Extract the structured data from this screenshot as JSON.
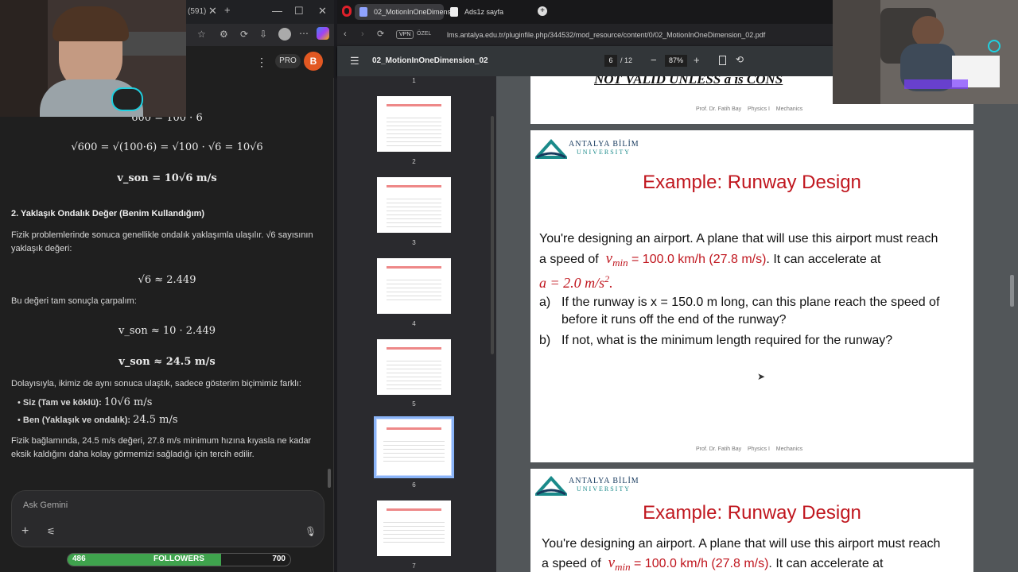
{
  "left": {
    "tab_count": "(591)",
    "pro_label": "PRO",
    "avatar_letter": "B",
    "math": {
      "eq1": "600 = 100 · 6",
      "eq2": "√600 = √(100·6) = √100 · √6 = 10√6",
      "eq3": "v_son = 10√6 m/s",
      "eq4": "√6 ≈ 2.449",
      "eq5": "v_son ≈ 10 · 2.449",
      "eq6": "v_son ≈ 24.5 m/s"
    },
    "heading2": "2. Yaklaşık Ondalık Değer (Benim Kullandığım)",
    "para1": "Fizik problemlerinde sonuca genellikle ondalık yaklaşımla ulaşılır. √6 sayısının yaklaşık değeri:",
    "para2": "Bu değeri tam sonuçla çarpalım:",
    "para3": "Dolayısıyla, ikimiz de aynı sonuca ulaştık, sadece gösterim biçimimiz farklı:",
    "bullets": [
      {
        "label": "Siz (Tam ve köklü):",
        "value": "10√6 m/s"
      },
      {
        "label": "Ben (Yaklaşık ve ondalık):",
        "value": "24.5 m/s"
      }
    ],
    "para4": "Fizik bağlamında, 24.5 m/s değeri, 27.8 m/s minimum hızına kıyasla ne kadar eksik kaldığını daha kolay görmemizi sağladığı için tercih edilir.",
    "ask_placeholder": "Ask Gemini",
    "followers": {
      "current": "486",
      "label": "FOLLOWERS",
      "goal": "700",
      "progress": 0.69
    }
  },
  "right": {
    "tabs": [
      {
        "label": "02_MotionInOneDimensio"
      },
      {
        "label": "Ads1z sayfa"
      }
    ],
    "vpn": "VPN",
    "ozel": "ÖZEL",
    "url": "lms.antalya.edu.tr/pluginfile.php/344532/mod_resource/content/0/02_MotionInOneDimension_02.pdf",
    "pdf": {
      "title": "02_MotionInOneDimension_02",
      "page": "6",
      "total": "/ 12",
      "zoom": "87%"
    },
    "thumb_numbers": [
      "1",
      "2",
      "3",
      "4",
      "5",
      "6",
      "7"
    ],
    "prev_page_title": "NOT VALID UNLESS a is CONS",
    "footer": {
      "author": "Prof. Dr. Fatih Bay",
      "course": "Physics I",
      "topic": "Mechanics"
    },
    "logo_line1": "ANTALYA BİLİM",
    "logo_line2": "UNIVERSITY",
    "slide": {
      "title": "Example: Runway Design",
      "intro1": "You're designing an airport. A plane that will use this airport must reach",
      "intro2a": "a speed of",
      "vmin": "v",
      "vmin_sub": "min",
      "intro2b": "= 100.0 km/h (27.8 m/s)",
      "intro2c": ". It can accelerate at",
      "accel": "a = 2.0 m/s",
      "accel_exp": "2",
      "qa_label": "a)",
      "qa1": "If the runway is x = 150.0 m long, can this plane reach the speed of",
      "qa2": "before it runs off the end of the runway?",
      "qb_label": "b)",
      "qb": "If not, what is the minimum length required for the runway?"
    }
  }
}
